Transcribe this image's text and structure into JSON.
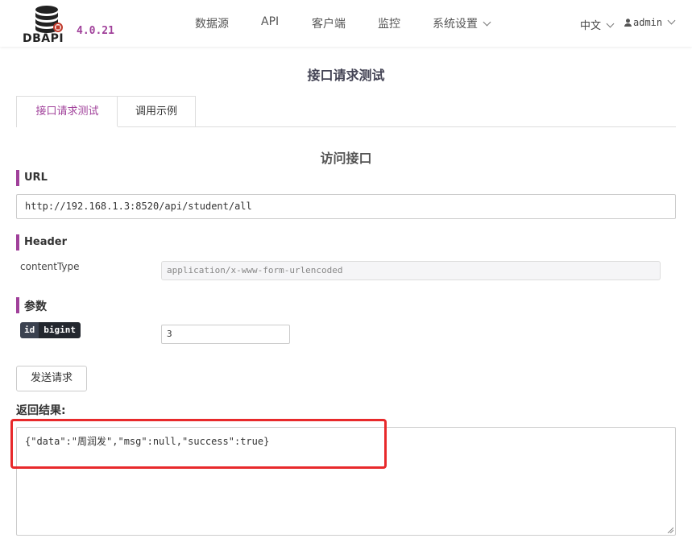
{
  "header": {
    "logo_text": "DBAPI",
    "version": "4.0.21",
    "nav": [
      {
        "label": "数据源"
      },
      {
        "label": "API"
      },
      {
        "label": "客户端"
      },
      {
        "label": "监控"
      },
      {
        "label": "系统设置"
      }
    ],
    "language": "中文",
    "user": "admin"
  },
  "page": {
    "title": "接口请求测试",
    "tabs": [
      {
        "label": "接口请求测试",
        "active": true
      },
      {
        "label": "调用示例",
        "active": false
      }
    ],
    "section_title": "访问接口",
    "url_label": "URL",
    "url_value": "http://192.168.1.3:8520/api/student/all",
    "header_label": "Header",
    "header_name": "contentType",
    "header_value": "application/x-www-form-urlencoded",
    "params_label": "参数",
    "param": {
      "name": "id",
      "type": "bigint",
      "value": "3"
    },
    "send_label": "发送请求",
    "result_label": "返回结果:",
    "result_text": "{\"data\":\"周润发\",\"msg\":null,\"success\":true}"
  },
  "colors": {
    "accent": "#a0409a",
    "highlight": "#e8292b"
  }
}
